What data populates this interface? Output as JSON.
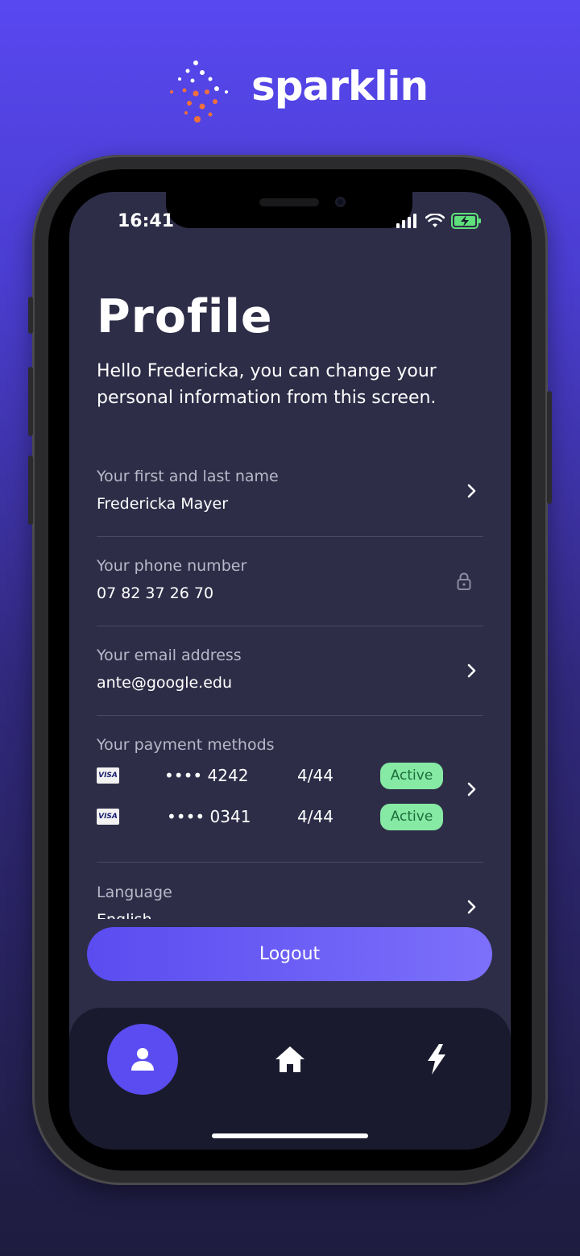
{
  "brand": {
    "name": "sparklin"
  },
  "status_bar": {
    "time": "16:41"
  },
  "profile": {
    "title": "Profile",
    "greeting": "Hello Fredericka, you can change your personal information from this screen."
  },
  "fields": {
    "name": {
      "label": "Your first and last name",
      "value": "Fredericka Mayer"
    },
    "phone": {
      "label": "Your phone number",
      "value": "07 82 37 26 70"
    },
    "email": {
      "label": "Your email address",
      "value": "ante@google.edu"
    },
    "language": {
      "label": "Language",
      "value": "English"
    }
  },
  "payments": {
    "label": "Your payment methods",
    "cards": [
      {
        "brand": "VISA",
        "number": "•••• 4242",
        "expiry": "4/44",
        "status": "Active"
      },
      {
        "brand": "VISA",
        "number": "•••• 0341",
        "expiry": "4/44",
        "status": "Active"
      }
    ]
  },
  "actions": {
    "logout": "Logout"
  },
  "tabs": [
    {
      "icon": "user-icon",
      "active": true
    },
    {
      "icon": "home-icon",
      "active": false
    },
    {
      "icon": "lightning-icon",
      "active": false
    }
  ],
  "colors": {
    "accent": "#5a4cf0",
    "badge_bg": "#86e9a4",
    "screen_bg": "#2e2d48",
    "tabbar_bg": "#1a1a2e"
  }
}
